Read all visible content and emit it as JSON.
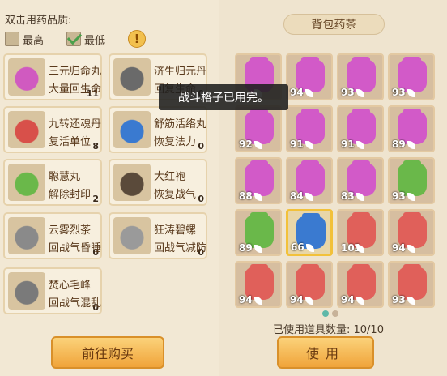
{
  "quality": {
    "title": "双击用药品质:",
    "options": [
      {
        "label": "最高",
        "checked": false
      },
      {
        "label": "最低",
        "checked": true
      }
    ],
    "warn_glyph": "!"
  },
  "medicines": [
    {
      "name": "三元归命丸",
      "effect": "大量回生命",
      "count": "11",
      "icon": "pink-bottle-icon",
      "color": "#d05ac0"
    },
    {
      "name": "济生归元丹",
      "effect": "回复生命",
      "count": "0",
      "icon": "pills-plate-icon",
      "color": "#6a6a6a"
    },
    {
      "name": "九转还魂丹",
      "effect": "复活单位",
      "count": "8",
      "icon": "red-jar-icon",
      "color": "#d8504a"
    },
    {
      "name": "舒筋活络丸",
      "effect": "恢复法力",
      "count": "0",
      "icon": "blue-gourd-icon",
      "color": "#3a7ad0"
    },
    {
      "name": "聪慧丸",
      "effect": "解除封印",
      "count": "2",
      "icon": "green-vase-icon",
      "color": "#6ab84a"
    },
    {
      "name": "大红袍",
      "effect": "恢复战气",
      "count": "0",
      "icon": "tea-bowl-icon",
      "color": "#5a4a3a"
    },
    {
      "name": "云雾烈茶",
      "effect": "回战气昏睡",
      "count": "0",
      "icon": "tea-cup-icon",
      "color": "#8a8a8a"
    },
    {
      "name": "狂涛碧螺",
      "effect": "回战气减防",
      "count": "0",
      "icon": "tea-cup-icon",
      "color": "#9a9a9a"
    },
    {
      "name": "焚心毛峰",
      "effect": "回战气混乱",
      "count": "0",
      "icon": "teapot-icon",
      "color": "#7a7a7a"
    }
  ],
  "buy_label": "前往购买",
  "bag_title": "背包药茶",
  "bag_slots": [
    {
      "q": "",
      "color": "#d25ac8",
      "selected": false
    },
    {
      "q": "94",
      "color": "#d25ac8",
      "selected": false
    },
    {
      "q": "93",
      "color": "#d25ac8",
      "selected": false
    },
    {
      "q": "93",
      "color": "#d25ac8",
      "selected": false
    },
    {
      "q": "92",
      "color": "#d25ac8",
      "selected": false
    },
    {
      "q": "91",
      "color": "#d25ac8",
      "selected": false
    },
    {
      "q": "91",
      "color": "#d25ac8",
      "selected": false
    },
    {
      "q": "89",
      "color": "#d25ac8",
      "selected": false
    },
    {
      "q": "88",
      "color": "#d25ac8",
      "selected": false
    },
    {
      "q": "84",
      "color": "#d25ac8",
      "selected": false
    },
    {
      "q": "83",
      "color": "#d25ac8",
      "selected": false
    },
    {
      "q": "93",
      "color": "#6ab84a",
      "selected": false
    },
    {
      "q": "89",
      "color": "#6ab84a",
      "selected": false
    },
    {
      "q": "66",
      "color": "#3a7ad0",
      "selected": true
    },
    {
      "q": "101",
      "color": "#e0605a",
      "selected": false
    },
    {
      "q": "94",
      "color": "#e0605a",
      "selected": false
    },
    {
      "q": "94",
      "color": "#e0605a",
      "selected": false
    },
    {
      "q": "94",
      "color": "#e0605a",
      "selected": false
    },
    {
      "q": "94",
      "color": "#e0605a",
      "selected": false
    },
    {
      "q": "93",
      "color": "#e0605a",
      "selected": false
    }
  ],
  "pages": {
    "count": 2,
    "active": 0
  },
  "used_text": "已使用道具数量: 10/10",
  "use_label": "使用",
  "toast": "战斗格子已用完。"
}
